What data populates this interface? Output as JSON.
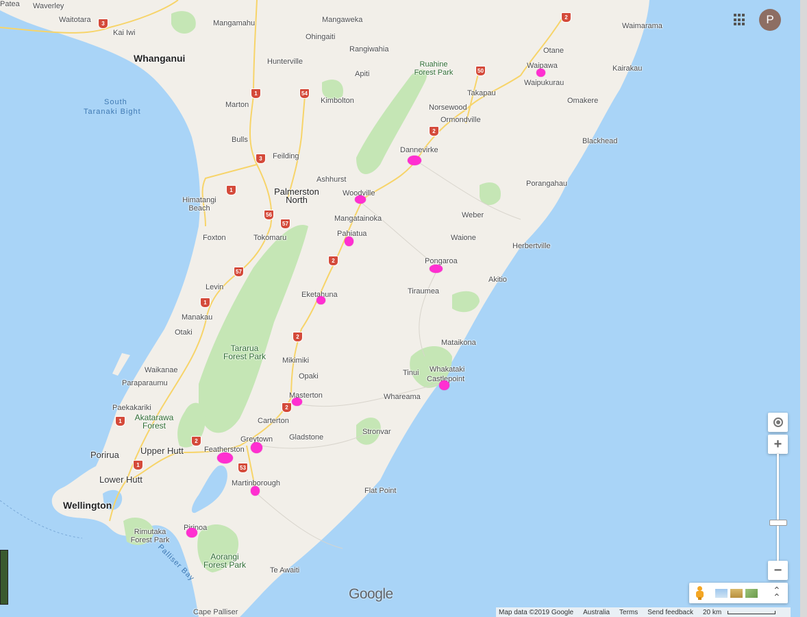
{
  "user": {
    "avatar_letter": "P",
    "avatar_color": "#8d6e63"
  },
  "colors": {
    "water": "#a9d4f7",
    "land": "#f2efe9",
    "forest": "#c5e6b5",
    "pin": "#ff2fd1",
    "road": "#f7d469"
  },
  "icons": {
    "apps": "apps-grid-icon",
    "locate": "my-location-icon",
    "pegman": "pegman-icon",
    "expand": "chevron-up-icon"
  },
  "labels": {
    "patea": "Patea",
    "waverley": "Waverley",
    "waitotara": "Waitotara",
    "kai_iwi": "Kai Iwi",
    "whanganui": "Whanganui",
    "south": "South",
    "taranaki_bight": "Taranaki Bight",
    "mangamahu": "Mangamahu",
    "mangaweka": "Mangaweka",
    "ohingaiti": "Ohingaiti",
    "rangiwahia": "Rangiwahia",
    "hunterville": "Hunterville",
    "apiti": "Apiti",
    "kimbolton": "Kimbolton",
    "marton": "Marton",
    "bulls": "Bulls",
    "feilding": "Feilding",
    "ashhurst": "Ashhurst",
    "palmerston_north": "Palmerston North",
    "himatangi_beach": "Himatangi Beach",
    "woodville": "Woodville",
    "mangatainoka": "Mangatainoka",
    "foxton": "Foxton",
    "tokomaru": "Tokomaru",
    "pahiatua": "Pahiatua",
    "levin": "Levin",
    "eketahuna": "Eketahuna",
    "manakau": "Manakau",
    "otaki": "Otaki",
    "tararua_forest_park": "Tararua Forest Park",
    "waikanae": "Waikanae",
    "paraparaumu": "Paraparaumu",
    "mikimiki": "Mikimiki",
    "opaki": "Opaki",
    "masterton": "Masterton",
    "paekakariki": "Paekakariki",
    "akatarawa_forest": "Akatarawa Forest",
    "carterton": "Carterton",
    "greytown": "Greytown",
    "gladstone": "Gladstone",
    "featherston": "Featherston",
    "porirua": "Porirua",
    "upper_hutt": "Upper Hutt",
    "lower_hutt": "Lower Hutt",
    "wellington": "Wellington",
    "martinborough": "Martinborough",
    "pirinoa": "Pirinoa",
    "rimutaka_forest_park": "Rimutaka Forest Park",
    "palliser_bay": "Palliser Bay",
    "aorangi_forest_park": "Aorangi Forest Park",
    "te_awaiti": "Te Awaiti",
    "cape_palliser": "Cape Palliser",
    "ruahine_forest_park": "Ruahine Forest Park",
    "waipawa": "Waipawa",
    "waipukurau": "Waipukurau",
    "otane": "Otane",
    "waimarama": "Waimarama",
    "kairakau": "Kairakau",
    "omakere": "Omakere",
    "takapau": "Takapau",
    "norsewood": "Norsewood",
    "ormondville": "Ormondville",
    "blackhead": "Blackhead",
    "dannevirke": "Dannevirke",
    "porangahau": "Porangahau",
    "weber": "Weber",
    "waione": "Waione",
    "herbertville": "Herbertville",
    "pongaroa": "Pongaroa",
    "akitio": "Akitio",
    "tiraumea": "Tiraumea",
    "mataikona": "Mataikona",
    "tinui": "Tinui",
    "whakataki": "Whakataki",
    "castlepoint": "Castlepoint",
    "whareama": "Whareama",
    "stronvar": "Stronvar",
    "flat_point": "Flat Point"
  },
  "routes": {
    "r3a": "3",
    "r3b": "3",
    "r1a": "1",
    "r1b": "1",
    "r1c": "1",
    "r1d": "1",
    "r1e": "1",
    "r54": "54",
    "r56": "56",
    "r57a": "57",
    "r57b": "57",
    "r50": "50",
    "r2a": "2",
    "r2b": "2",
    "r2c": "2",
    "r2d": "2",
    "r2e": "2",
    "r2f": "2",
    "r2g": "2",
    "r53": "53"
  },
  "controls": {
    "zoom_in": "+",
    "zoom_out": "−",
    "zoom_level": 0.22
  },
  "google_logo": "Google",
  "attribution": {
    "map_data": "Map data ©2019 Google",
    "region": "Australia",
    "terms": "Terms",
    "feedback": "Send feedback",
    "scale": "20 km"
  }
}
